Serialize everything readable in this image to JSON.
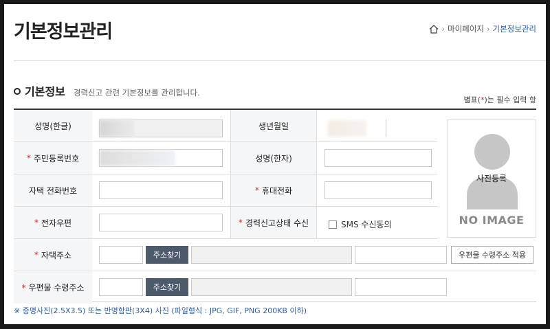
{
  "page": {
    "title": "기본정보관리",
    "breadcrumb": [
      "마이페이지",
      "기본정보관리"
    ]
  },
  "section": {
    "title": "기본정보",
    "description": "경력신고 관련 기본정보를 관리합니다.",
    "required_note_prefix": "별표(",
    "required_note_star": "*",
    "required_note_suffix": ")는 필수 입력 항"
  },
  "form": {
    "name_kor_label": "성명(한글)",
    "birth_label": "생년월일",
    "rrn_label": "주민등록번호",
    "name_hanja_label": "성명(한자)",
    "home_phone_label": "자택 전화번호",
    "mobile_label": "휴대전화",
    "email_label": "전자우편",
    "status_receive_label": "경력신고상태 수신",
    "sms_label": "SMS 수신동의",
    "home_address_label": "자택주소",
    "mail_address_label": "우편물 수령주소",
    "find_address_button": "주소찾기",
    "apply_mail_button": "우편물 수령주소 적용",
    "required_star": "*"
  },
  "photo": {
    "label": "사진등록",
    "no_image": "NO IMAGE"
  },
  "footnote": "※ 증명사진(2.5X3.5) 또는 반명함판(3X4) 사진 (파일형식 : JPG, GIF, PNG 200KB 이하)"
}
